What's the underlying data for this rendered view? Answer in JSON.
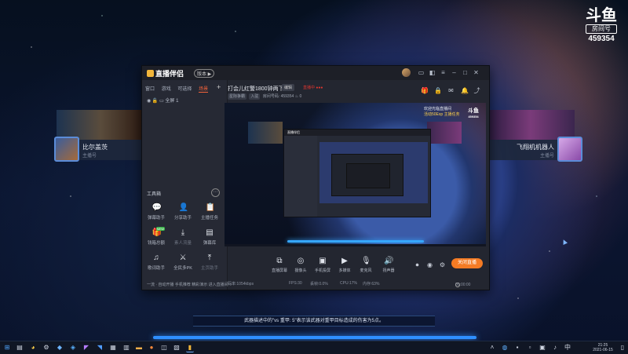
{
  "douyu": {
    "brand": "斗鱼",
    "room_label": "房间号",
    "room_number": "459354"
  },
  "banner_left": {
    "name": "比尔盖茨",
    "sub": "主播号"
  },
  "banner_right": {
    "name": "飞翔机机器人",
    "sub": "主播号"
  },
  "app": {
    "logo_text": "直播伴侣",
    "version_badge": "版本 ▶",
    "title": "打会儿红警1800钟两下",
    "edit_label": "编辑",
    "live_flag": "直播中 ●●●",
    "info": {
      "category": "星际争霸",
      "tag": "入驻",
      "room_prefix": "房间号码:",
      "room_number": "459354",
      "heat": "0"
    },
    "sidebar_tabs": [
      "窗口",
      "游戏",
      "可选择",
      "场景"
    ],
    "scene_label": "全屏 1",
    "tools_title": "工具箱",
    "tools": [
      {
        "icon": "弹幕助手",
        "label": "弹幕助手"
      },
      {
        "icon": "分享助手",
        "label": "分享助手"
      },
      {
        "icon": "主播任务",
        "label": "主播任务"
      },
      {
        "icon": "钱箱总额",
        "label": "钱箱总额",
        "new": "NEW"
      },
      {
        "icon": "素人流量",
        "label": "素人流量"
      },
      {
        "icon": "弹幕库",
        "label": "弹幕库"
      },
      {
        "icon": "歌词助手",
        "label": "歌词助手"
      },
      {
        "icon": "全民多PK",
        "label": "全民多PK"
      },
      {
        "icon": "主页助手",
        "label": "主页助手"
      }
    ],
    "sidebar_footer": "一流 · 自动开播   手机推荐   精彩演示   进入直播间 ○"
  },
  "preview": {
    "notice_line1": "欢迎光临直播间",
    "notice_line2": "活动50Exp 主播任务",
    "dy_brand": "斗鱼",
    "dy_room": "459354"
  },
  "controls": [
    {
      "icon": "直播屏幕",
      "label": "直播屏幕"
    },
    {
      "icon": "摄像头",
      "label": "摄像头"
    },
    {
      "icon": "手机投屏",
      "label": "手机投屏"
    },
    {
      "icon": "多媒体",
      "label": "多媒体"
    },
    {
      "icon": "麦克风",
      "label": "麦克风"
    },
    {
      "icon": "扬声器",
      "label": "扬声器"
    }
  ],
  "go_live_label": "关闭直播",
  "statusbar": {
    "bitrate": "码率:1054kbps",
    "fps": "FPS:30",
    "dropped": "丢帧:0.0%",
    "cpu": "CPU:17%",
    "mem": "内存:63%",
    "time": "00:00:00"
  },
  "subtitle": "武器描述中的\"vs 重甲: 5\"表示该武器对重甲目标造成的伤害为5点。",
  "taskbar": {
    "time": "21:25",
    "date": "2021-06-15"
  }
}
